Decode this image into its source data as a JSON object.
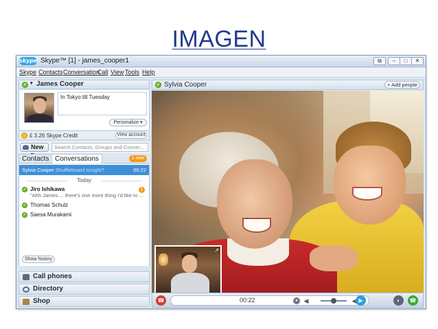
{
  "slide": {
    "title": "IMAGEN"
  },
  "window": {
    "title": "Skype™ [1] - james_cooper1",
    "logo": "skype",
    "controls": [
      "restore-icon",
      "minimize-icon",
      "maximize-icon",
      "close-icon"
    ]
  },
  "menu": [
    "Skype",
    "Contacts",
    "Conversation",
    "Call",
    "View",
    "Tools",
    "Help"
  ],
  "profile": {
    "name": "James Cooper",
    "mood": "In Tokyo till Tuesday",
    "personalize": "Personalize ▾",
    "credit": "£ 3.26 Skype Credit",
    "view_account": "View account"
  },
  "toolbar": {
    "new_label": "New ▾",
    "search_placeholder": "Search Contacts, Groups and Conver..."
  },
  "tabs": {
    "contacts": "Contacts",
    "conversations": "Conversations",
    "new_badge": "1 new"
  },
  "conversations": {
    "selected": {
      "name": "Sylvia Cooper",
      "preview": "Shuffleboard tonight?",
      "time": "00:22"
    },
    "today_label": "Today",
    "items": [
      {
        "name": "Jiro Ishikawa",
        "preview": "\"Ahh James.... there's one more thing I'd like to ...",
        "unread": "1"
      },
      {
        "name": "Thomas Schulz"
      },
      {
        "name": "Saesa Murakami"
      }
    ],
    "show_history": "Show history"
  },
  "bottom_buttons": {
    "call_phones": "Call phones",
    "directory": "Directory",
    "shop": "Shop"
  },
  "call": {
    "contact_name": "Sylvia Cooper",
    "add_people": "+ Add people",
    "duration": "00:22",
    "volume_level": 0.5
  },
  "colors": {
    "online": "#6fbf2e",
    "selected_row": "#3f8fd6",
    "badge": "#f39a1e",
    "end_call": "#d93a2f",
    "answer": "#3ca63c"
  }
}
